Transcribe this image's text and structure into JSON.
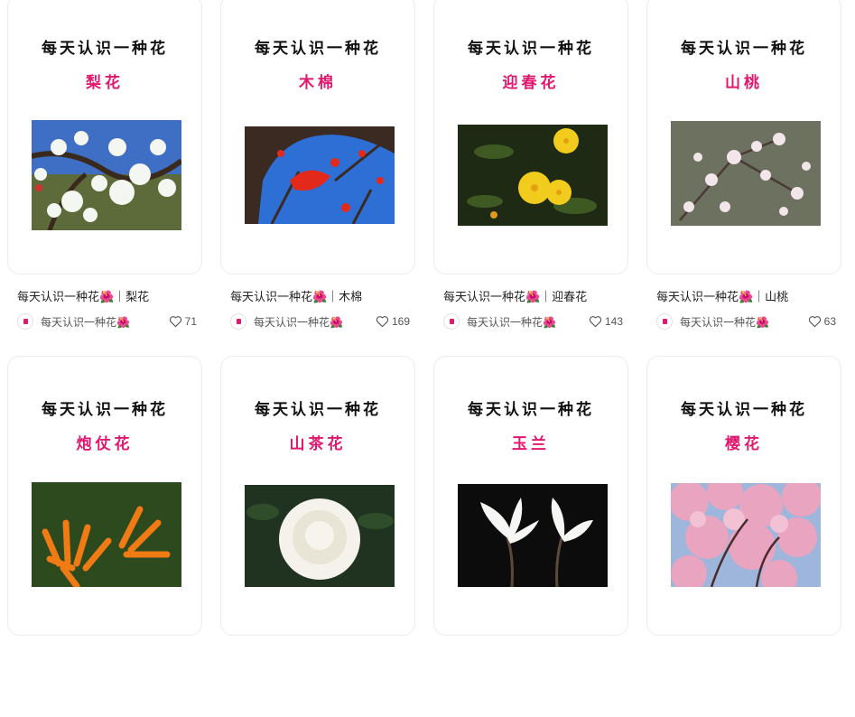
{
  "cards": [
    {
      "cover_heading": "每天认识一种花",
      "cover_name": "梨花",
      "title": "每天认识一种花🌺｜梨花",
      "author": "每天认识一种花🌺",
      "likes": "71",
      "photo": "pear-blossom"
    },
    {
      "cover_heading": "每天认识一种花",
      "cover_name": "木棉",
      "title": "每天认识一种花🌺｜木棉",
      "author": "每天认识一种花🌺",
      "likes": "169",
      "photo": "kapok-flower"
    },
    {
      "cover_heading": "每天认识一种花",
      "cover_name": "迎春花",
      "title": "每天认识一种花🌺｜迎春花",
      "author": "每天认识一种花🌺",
      "likes": "143",
      "photo": "winter-jasmine"
    },
    {
      "cover_heading": "每天认识一种花",
      "cover_name": "山桃",
      "title": "每天认识一种花🌺｜山桃",
      "author": "每天认识一种花🌺",
      "likes": "63",
      "photo": "mountain-peach"
    },
    {
      "cover_heading": "每天认识一种花",
      "cover_name": "炮仗花",
      "photo": "firecracker-vine"
    },
    {
      "cover_heading": "每天认识一种花",
      "cover_name": "山茶花",
      "photo": "camellia"
    },
    {
      "cover_heading": "每天认识一种花",
      "cover_name": "玉兰",
      "photo": "magnolia"
    },
    {
      "cover_heading": "每天认识一种花",
      "cover_name": "樱花",
      "photo": "cherry-blossom"
    }
  ]
}
